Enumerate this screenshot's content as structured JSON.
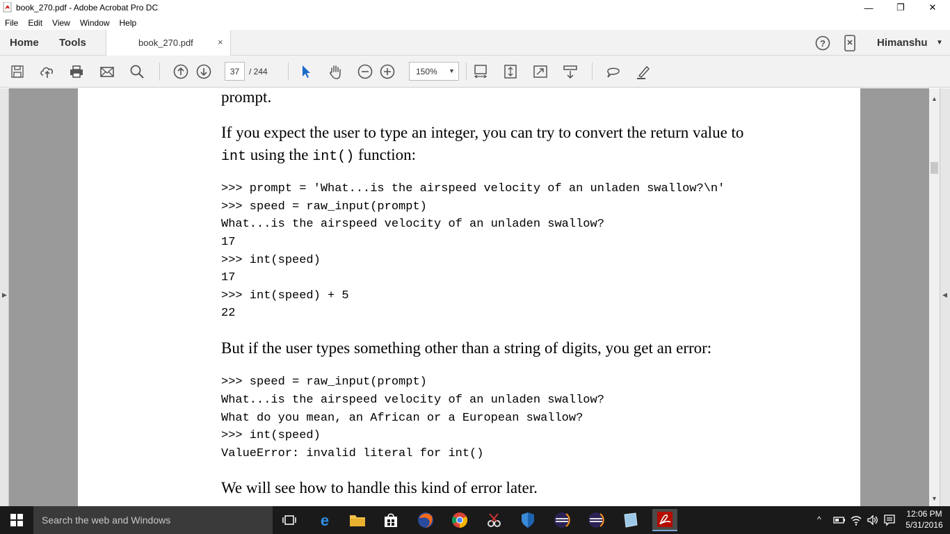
{
  "window": {
    "title": "book_270.pdf - Adobe Acrobat Pro DC",
    "minimize": "—",
    "restore": "❐",
    "close": "✕"
  },
  "menu": [
    "File",
    "Edit",
    "View",
    "Window",
    "Help"
  ],
  "tabs": {
    "home": "Home",
    "tools": "Tools",
    "document": "book_270.pdf",
    "close": "×",
    "user": "Himanshu"
  },
  "toolbar": {
    "page_current": "37",
    "page_total": "/ 244",
    "zoom": "150%"
  },
  "document": {
    "line_top": "prompt.",
    "para1_line1": "If you expect the user to type an integer, you can try to convert the return value to",
    "para1_line2_code1": "int",
    "para1_line2_text1": " using the ",
    "para1_line2_code2": "int()",
    "para1_line2_text2": " function:",
    "code1": [
      ">>> prompt = 'What...is the airspeed velocity of an unladen swallow?\\n'",
      ">>> speed = raw_input(prompt)",
      "What...is the airspeed velocity of an unladen swallow?",
      "17",
      ">>> int(speed)",
      "17",
      ">>> int(speed) + 5",
      "22"
    ],
    "para2": "But if the user types something other than a string of digits, you get an error:",
    "code2": [
      ">>> speed = raw_input(prompt)",
      "What...is the airspeed velocity of an unladen swallow?",
      "What do you mean, an African or a European swallow?",
      ">>> int(speed)",
      "ValueError: invalid literal for int()"
    ],
    "para3": "We will see how to handle this kind of error later."
  },
  "taskbar": {
    "search_placeholder": "Search the web and Windows",
    "time": "12:06 PM",
    "date": "5/31/2016"
  }
}
